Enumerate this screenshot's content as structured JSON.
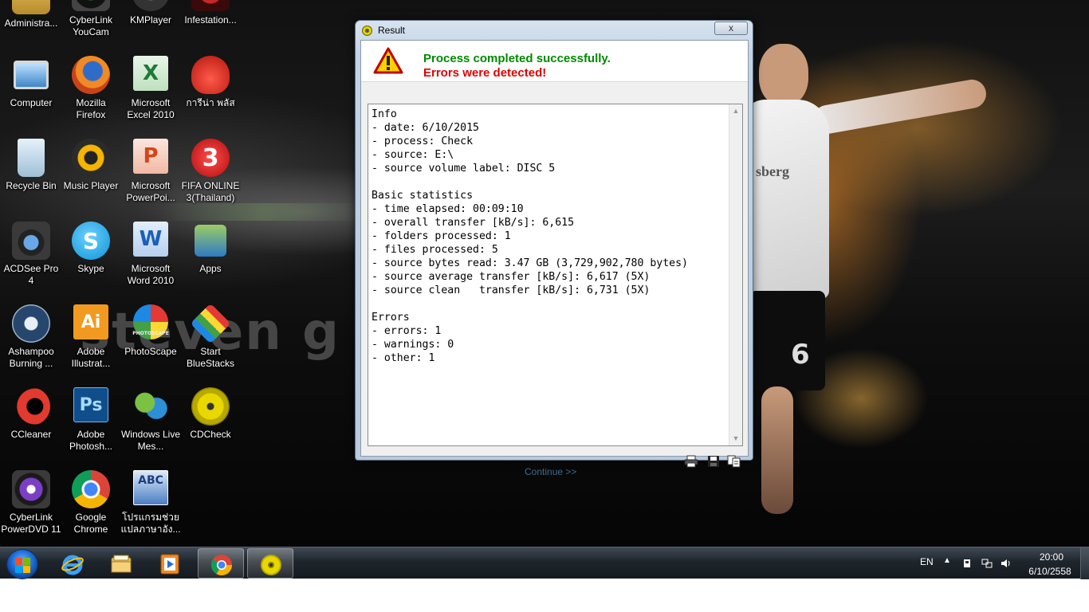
{
  "desktop": {
    "wallpaper_text": "steven g",
    "wallpaper_shirt_brand": "sberg",
    "wallpaper_shirt_number": "6",
    "icons": [
      {
        "label": "Administra...",
        "icon": "admin-folder-icon"
      },
      {
        "label": "CyberLink YouCam",
        "icon": "youcam-icon"
      },
      {
        "label": "KMPlayer",
        "icon": "kmplayer-icon"
      },
      {
        "label": "Infestation...",
        "icon": "infestation-icon"
      },
      {
        "label": "Computer",
        "icon": "computer-icon"
      },
      {
        "label": "Mozilla Firefox",
        "icon": "firefox-icon"
      },
      {
        "label": "Microsoft Excel 2010",
        "icon": "excel-icon"
      },
      {
        "label": "การีน่า พลัส",
        "icon": "garena-icon"
      },
      {
        "label": "Recycle Bin",
        "icon": "recycle-bin-icon"
      },
      {
        "label": "Music Player",
        "icon": "music-player-icon"
      },
      {
        "label": "Microsoft PowerPoi...",
        "icon": "powerpoint-icon"
      },
      {
        "label": "FIFA ONLINE 3(Thailand)",
        "icon": "fifa-online-icon"
      },
      {
        "label": "ACDSee Pro 4",
        "icon": "acdsee-icon"
      },
      {
        "label": "Skype",
        "icon": "skype-icon"
      },
      {
        "label": "Microsoft Word 2010",
        "icon": "word-icon"
      },
      {
        "label": "Apps",
        "icon": "apps-icon"
      },
      {
        "label": "Ashampoo Burning ...",
        "icon": "ashampoo-icon"
      },
      {
        "label": "Adobe Illustrat...",
        "icon": "illustrator-icon"
      },
      {
        "label": "PhotoScape",
        "icon": "photoscape-icon"
      },
      {
        "label": "Start BlueStacks",
        "icon": "bluestacks-icon"
      },
      {
        "label": "CCleaner",
        "icon": "ccleaner-icon"
      },
      {
        "label": "Adobe Photosh...",
        "icon": "photoshop-icon"
      },
      {
        "label": "Windows Live Mes...",
        "icon": "messenger-icon"
      },
      {
        "label": "CDCheck",
        "icon": "cdcheck-icon"
      },
      {
        "label": "CyberLink PowerDVD 11",
        "icon": "powerdvd-icon"
      },
      {
        "label": "Google Chrome",
        "icon": "chrome-icon"
      },
      {
        "label": "โปรแกรมช่วยแปลภาษาอัง...",
        "icon": "translator-icon"
      }
    ],
    "icon_glyphs": {
      "illustrator": "Ai",
      "photoshop": "Ps",
      "word": "W",
      "excel": "X",
      "powerpoint": "P",
      "fifa": "3",
      "skype": "S",
      "abc": "ABC",
      "photoscape": "PHOTOSCAPE"
    }
  },
  "window": {
    "title": "Result",
    "close_label": "x",
    "success_message": "Process completed successfully.",
    "error_message": "Errors were detected!",
    "log": "Info\n- date: 6/10/2015\n- process: Check\n- source: E:\\\n- source volume label: DISC 5\n\nBasic statistics\n- time elapsed: 00:09:10\n- overall transfer [kB/s]: 6,615\n- folders processed: 1\n- files processed: 5\n- source bytes read: 3.47 GB (3,729,902,780 bytes)\n- source average transfer [kB/s]: 6,617 (5X)\n- source clean   transfer [kB/s]: 6,731 (5X)\n\nErrors\n- errors: 1\n- warnings: 0\n- other: 1",
    "continue_label": "Continue >>",
    "scroll_up_glyph": "▲",
    "scroll_down_glyph": "▼",
    "toolbar_icons": [
      "print-icon",
      "save-icon",
      "copy-icon"
    ]
  },
  "taskbar": {
    "pinned": [
      "internet-explorer-icon",
      "explorer-folder-icon",
      "media-player-icon",
      "chrome-icon",
      "cdcheck-icon"
    ],
    "active_item": "cdcheck-icon",
    "language": "EN",
    "tray_arrow": "▲",
    "clock_time": "20:00",
    "clock_date": "6/10/2558"
  },
  "colors": {
    "success": "#008a00",
    "error": "#e00000",
    "link": "#3c6c8c"
  }
}
